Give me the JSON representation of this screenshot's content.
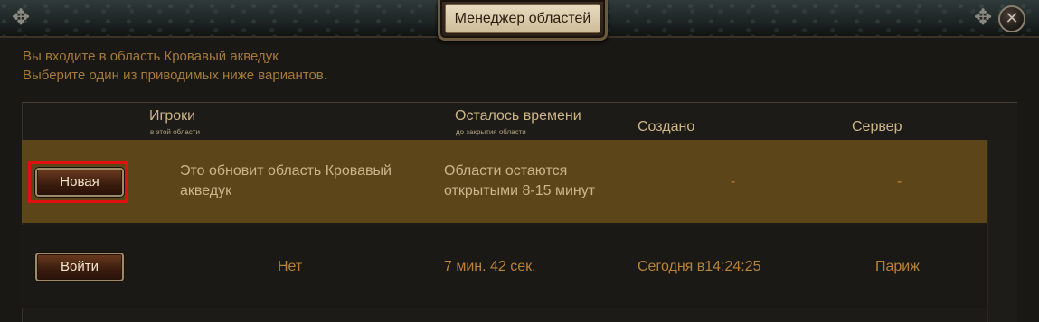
{
  "window": {
    "title": "Менеджер областей",
    "close_icon": "close-icon",
    "corner_ornament": "✥"
  },
  "intro": {
    "line1": "Вы входите в область Кровавый акведук",
    "line2": "Выберите один из приводимых ниже вариантов."
  },
  "table": {
    "headers": [
      {
        "label": "Игроки",
        "sublabel": "в этой области"
      },
      {
        "label": "Осталось времени",
        "sublabel": "до закрытия области"
      },
      {
        "label": "Создано",
        "sublabel": ""
      },
      {
        "label": "Сервер",
        "sublabel": ""
      }
    ],
    "rows": [
      {
        "button_label": "Новая",
        "players": [
          "Это обновит область Кровавый",
          "акведук"
        ],
        "time_left": [
          "Области остаются",
          "открытыми 8-15 минут"
        ],
        "created": "-",
        "server": "-",
        "selected": true
      },
      {
        "button_label": "Войти",
        "players": [
          "Нет"
        ],
        "time_left": [
          "7 мин. 42 сек."
        ],
        "created": "Сегодня в14:24:25",
        "server": "Париж",
        "selected": false
      }
    ]
  },
  "colors": {
    "highlight_row": "#5b4519",
    "text_gold": "#cdb58a",
    "text_orange": "#b8823a",
    "selection": "#e01010"
  }
}
